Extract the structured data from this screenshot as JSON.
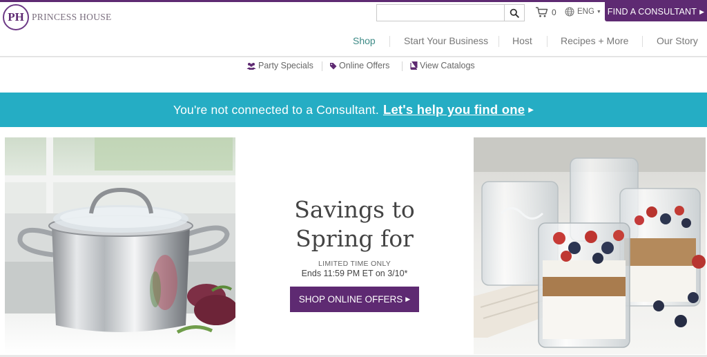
{
  "header": {
    "logo_monogram": "PH",
    "logo_text": "PRINCESS HOUSE",
    "search": {
      "value": "",
      "placeholder": ""
    },
    "cart_count": "0",
    "language": "ENG",
    "find_consultant_label": "FIND A CONSULTANT"
  },
  "main_nav": {
    "items": [
      {
        "label": "Shop",
        "active": true
      },
      {
        "label": "Start Your Business"
      },
      {
        "label": "Host"
      },
      {
        "label": "Recipes + More"
      },
      {
        "label": "Our Story"
      }
    ]
  },
  "sub_nav": {
    "items": [
      {
        "label": "Party Specials",
        "icon": "users-icon"
      },
      {
        "label": "Online Offers",
        "icon": "tag-icon"
      },
      {
        "label": "View Catalogs",
        "icon": "book-icon"
      }
    ]
  },
  "banner": {
    "text": "You're not connected to a Consultant.",
    "link_label": "Let's help you find one"
  },
  "promo": {
    "title_line1": "Savings to",
    "title_line2": "Spring for",
    "limited": "LIMITED TIME ONLY",
    "ends": "Ends 11:59 PM ET on 3/10*",
    "button_label": "SHOP ONLINE OFFERS"
  },
  "colors": {
    "brand_purple": "#5e2a72",
    "banner_teal": "#25adc4",
    "nav_active": "#3d8a86"
  }
}
